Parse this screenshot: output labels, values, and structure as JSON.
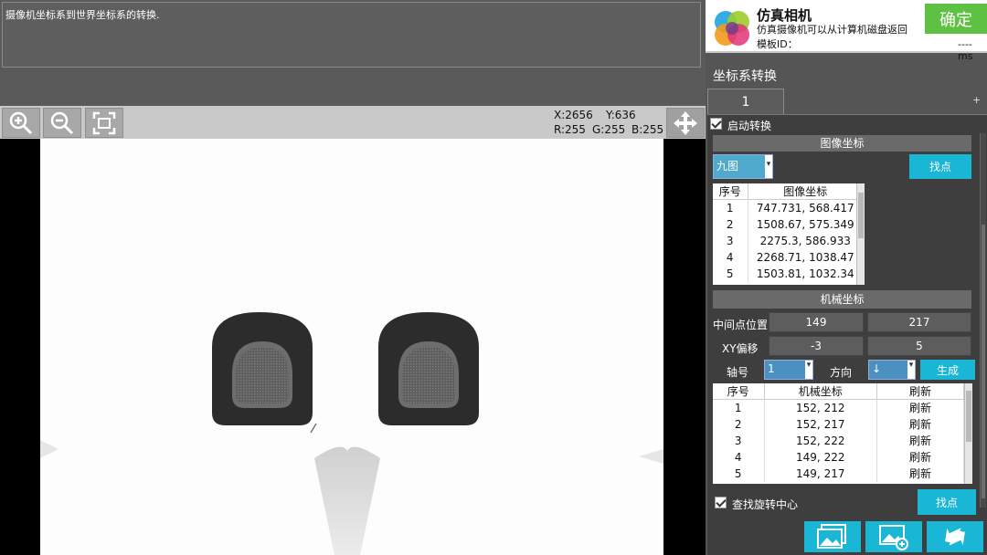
{
  "description": "摄像机坐标系到世界坐标系的转换.",
  "toolbar": {
    "x_readout": "X:2656",
    "y_readout": "Y:636",
    "r_readout": "R:255",
    "g_readout": "G:255",
    "b_readout": "B:255"
  },
  "header": {
    "title": "仿真相机",
    "subtitle": "仿真摄像机可以从计算机磁盘返回",
    "template_label": "模板ID：",
    "timing": "----ms",
    "confirm_label": "确定"
  },
  "section_title": "坐标系转换",
  "tab_label": "1",
  "tab_add": "+",
  "enable_label": "启动转换",
  "image_coords": {
    "bar_label": "图像坐标",
    "mode": "九图",
    "find_label": "找点",
    "headers": [
      "序号",
      "图像坐标"
    ],
    "rows": [
      [
        "1",
        "747.731, 568.417"
      ],
      [
        "2",
        "1508.67, 575.349"
      ],
      [
        "3",
        "2275.3, 586.933"
      ],
      [
        "4",
        "2268.71, 1038.47"
      ],
      [
        "5",
        "1503.81, 1032.34"
      ]
    ]
  },
  "machine_coords": {
    "bar_label": "机械坐标",
    "mid_label": "中间点位置",
    "mid_x": "149",
    "mid_y": "217",
    "offset_label": "XY偏移",
    "offset_x": "-3",
    "offset_y": "5",
    "axis_label": "轴号",
    "axis_value": "1",
    "dir_label": "方向",
    "dir_value": "↓",
    "generate_label": "生成",
    "headers": [
      "序号",
      "机械坐标",
      "刷新"
    ],
    "rows": [
      [
        "1",
        "152, 212",
        "刷新"
      ],
      [
        "2",
        "152, 217",
        "刷新"
      ],
      [
        "3",
        "152, 222",
        "刷新"
      ],
      [
        "4",
        "149, 222",
        "刷新"
      ],
      [
        "5",
        "149, 217",
        "刷新"
      ]
    ]
  },
  "rotation_label": "查找旋转中心",
  "rotation_find_label": "找点",
  "colors": {
    "accent": "#19b6d6",
    "confirm": "#5fc144"
  }
}
